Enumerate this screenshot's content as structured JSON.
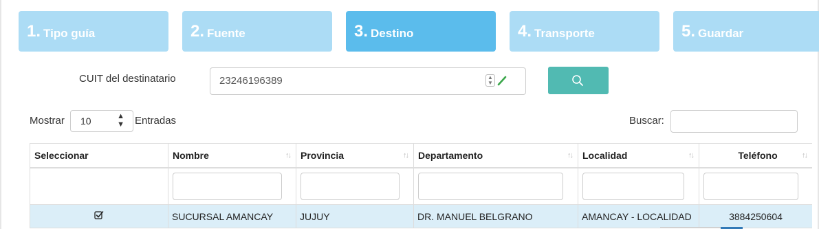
{
  "steps": [
    {
      "num": "1.",
      "label": "Tipo guía",
      "active": false
    },
    {
      "num": "2.",
      "label": "Fuente",
      "active": false
    },
    {
      "num": "3.",
      "label": "Destino",
      "active": true
    },
    {
      "num": "4.",
      "label": "Transporte",
      "active": false
    },
    {
      "num": "5.",
      "label": "Guardar",
      "active": false
    }
  ],
  "cuit": {
    "label": "CUIT del destinatario",
    "value": "23246196389"
  },
  "search_button_icon": "search-icon",
  "length": {
    "before": "Mostrar",
    "selected": "10",
    "after": "Entradas"
  },
  "filter": {
    "label": "Buscar:",
    "value": ""
  },
  "table": {
    "columns": [
      "Seleccionar",
      "Nombre",
      "Provincia",
      "Departamento",
      "Localidad",
      "Teléfono"
    ],
    "rows": [
      {
        "selected": true,
        "nombre": "SUCURSAL AMANCAY",
        "provincia": "JUJUY",
        "departamento": "DR. MANUEL BELGRANO",
        "localidad": "AMANCAY - LOCALIDAD",
        "telefono": "3884250604"
      }
    ]
  },
  "colors": {
    "step_inactive": "#acdcf5",
    "step_active": "#5bbcec",
    "search_button": "#51bab2",
    "row_highlight": "#dbeef8"
  }
}
